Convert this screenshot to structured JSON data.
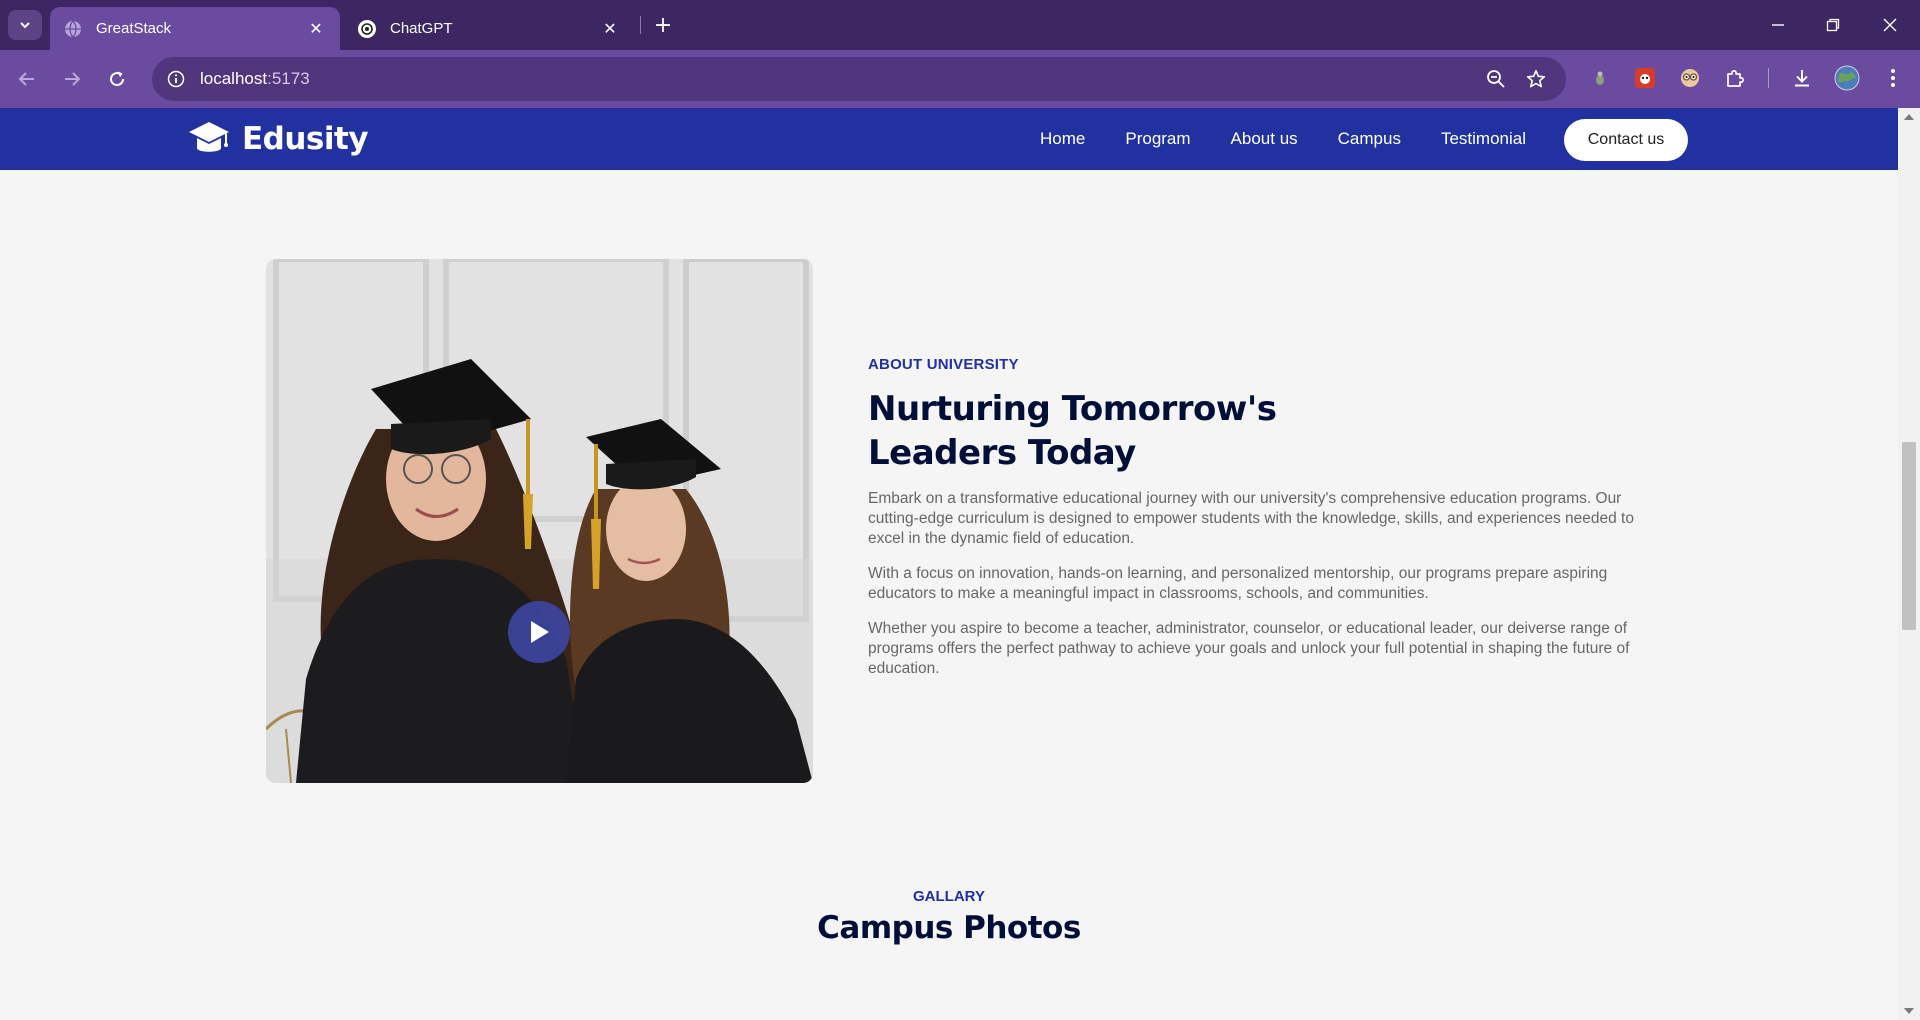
{
  "browser": {
    "tabs": [
      {
        "title": "GreatStack",
        "active": true,
        "favicon": "globe-icon"
      },
      {
        "title": "ChatGPT",
        "active": false,
        "favicon": "chatgpt-icon"
      }
    ],
    "url_host": "localhost",
    "url_port": ":5173",
    "colors": {
      "tabbar": "#3c2762",
      "toolbar": "#6a4ba0",
      "omnibox": "#51367e"
    }
  },
  "site": {
    "brand": "Edusity",
    "nav": [
      "Home",
      "Program",
      "About us",
      "Campus",
      "Testimonial"
    ],
    "contact_label": "Contact us",
    "colors": {
      "primary": "#2131a0",
      "heading": "#000f38",
      "body_text": "#676767"
    }
  },
  "about": {
    "eyebrow": "ABOUT UNIVERSITY",
    "heading": "Nurturing Tomorrow's Leaders Today",
    "paragraphs": [
      "Embark on a transformative educational journey with our university's comprehensive education programs. Our cutting-edge curriculum is designed to empower students with the knowledge, skills, and experiences needed to excel in the dynamic field of education.",
      "With a focus on innovation, hands-on learning, and personalized mentorship, our programs prepare aspiring educators to make a meaningful impact in classrooms, schools, and communities.",
      "Whether you aspire to become a teacher, administrator, counselor, or educational leader, our deiverse range of programs offers the perfect pathway to achieve your goals and unlock your full potential in shaping the future of education."
    ]
  },
  "gallery": {
    "eyebrow": "GALLARY",
    "title": "Campus Photos"
  }
}
